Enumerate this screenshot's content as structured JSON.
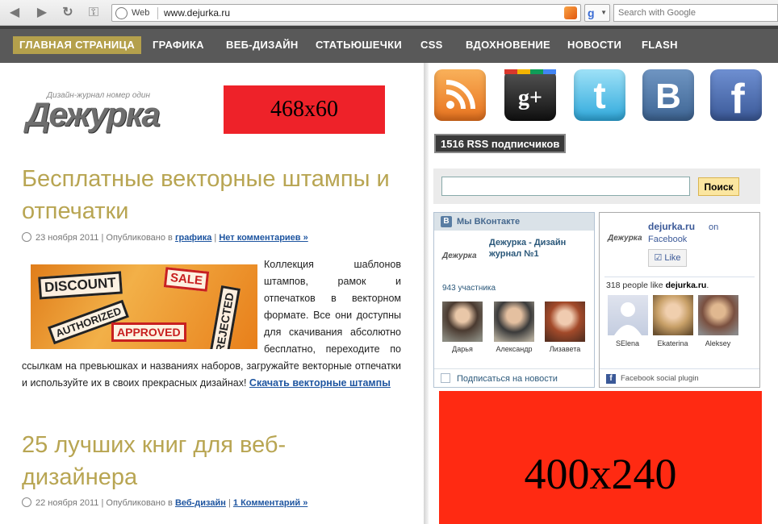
{
  "browser": {
    "scheme_label": "Web",
    "url": "www.dejurka.ru",
    "search_placeholder": "Search with Google",
    "search_engine_icon": "google-icon"
  },
  "nav": {
    "items": [
      "ГЛАВНАЯ СТРАНИЦА",
      "ГРАФИКА",
      "ВЕБ-ДИЗАЙН",
      "СТАТЬЮШЕЧКИ",
      "CSS",
      "ВДОХНОВЕНИЕ",
      "НОВОСТИ",
      "FLASH"
    ]
  },
  "logo": {
    "tagline": "Дизайн-журнал номер один",
    "name": "Дежурка"
  },
  "banner_top": "468x60",
  "posts": [
    {
      "title": "Бесплатные векторные штампы и отпечатки",
      "date": "23 ноября 2011",
      "published_in": "| Опубликовано в",
      "category": "графика",
      "comments": "Нет комментариев »",
      "body": "Коллекция шаблонов штампов, рамок и отпечатков в векторном формате. Все они доступны для скачивания абсолютно бесплатно, переходите по ссылкам на превьюшках и названиях наборов, загружайте векторные отпечатки и используйте их в своих прекрасных дизайнах!",
      "link": "Скачать векторные штампы",
      "stamps": [
        "DISCOUNT",
        "SALE",
        "AUTHORIZED",
        "APPROVED",
        "REJECTED"
      ]
    },
    {
      "title": "25 лучших книг для веб-дизайнера",
      "date": "22 ноября 2011",
      "published_in": "| Опубликовано в",
      "category": "Веб-дизайн",
      "comments": "1 Комментарий »"
    }
  ],
  "social": {
    "icons": [
      "rss-icon",
      "google-plus-icon",
      "twitter-icon",
      "vkontakte-icon",
      "facebook-icon"
    ],
    "rss_count": "1516",
    "rss_label": "RSS подписчиков",
    "search_button": "Поиск"
  },
  "vk_widget": {
    "title": "Мы ВКонтакте",
    "group_logo": "Дежурка",
    "group_name": "Дежурка - Дизайн журнал №1",
    "members": "943 участника",
    "people": [
      "Дарья",
      "Александр",
      "Лизавета"
    ],
    "subscribe": "Подписаться на новости"
  },
  "fb_widget": {
    "logo": "Дежурка",
    "site": "dejurka.ru",
    "on": "on",
    "network": "Facebook",
    "like": "Like",
    "count_prefix": "318 people like",
    "count_site": "dejurka.ru",
    "people": [
      "SElena",
      "Ekaterina",
      "Aleksey"
    ],
    "plugin": "Facebook social plugin"
  },
  "banner_side": "400x240",
  "colors": {
    "accent": "#b4a04c",
    "nav_bg": "#595959",
    "link": "#1e55a0",
    "banner_red": "#ee2229"
  }
}
